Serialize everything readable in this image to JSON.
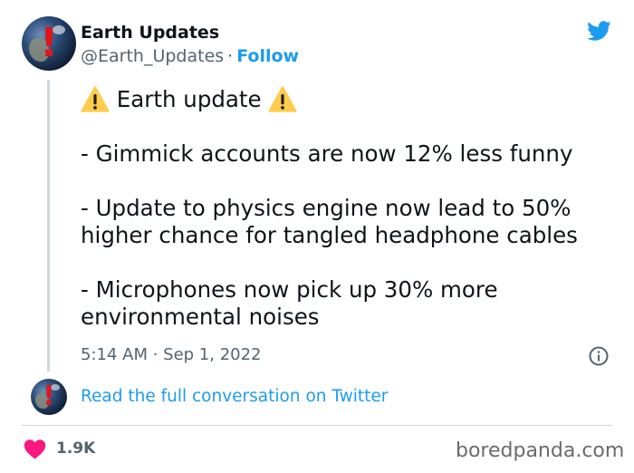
{
  "header": {
    "display_name": "Earth Updates",
    "handle": "@Earth_Updates",
    "separator": "·",
    "follow_label": "Follow"
  },
  "icons": {
    "avatar": "earth-avatar",
    "platform": "twitter-bird-icon",
    "warning": "warning-emoji",
    "info": "info-icon",
    "like": "heart-icon"
  },
  "tweet": {
    "title": "Earth update",
    "line1": "- Gimmick accounts are now 12% less funny",
    "line2a": "- Update to physics engine now lead to 50%",
    "line2b": "higher chance for tangled headphone cables",
    "line3a": "- Microphones now pick up 30% more",
    "line3b": "environmental noises"
  },
  "meta": {
    "timestamp": "5:14 AM · Sep 1, 2022"
  },
  "footer": {
    "read_link": "Read the full conversation on Twitter",
    "like_count": "1.9K",
    "watermark": "boredpanda.com"
  },
  "colors": {
    "accent": "#1d9bf0",
    "text": "#0f1419",
    "secondary": "#536471",
    "like": "#f91880",
    "warning": "#ffcc4d"
  }
}
